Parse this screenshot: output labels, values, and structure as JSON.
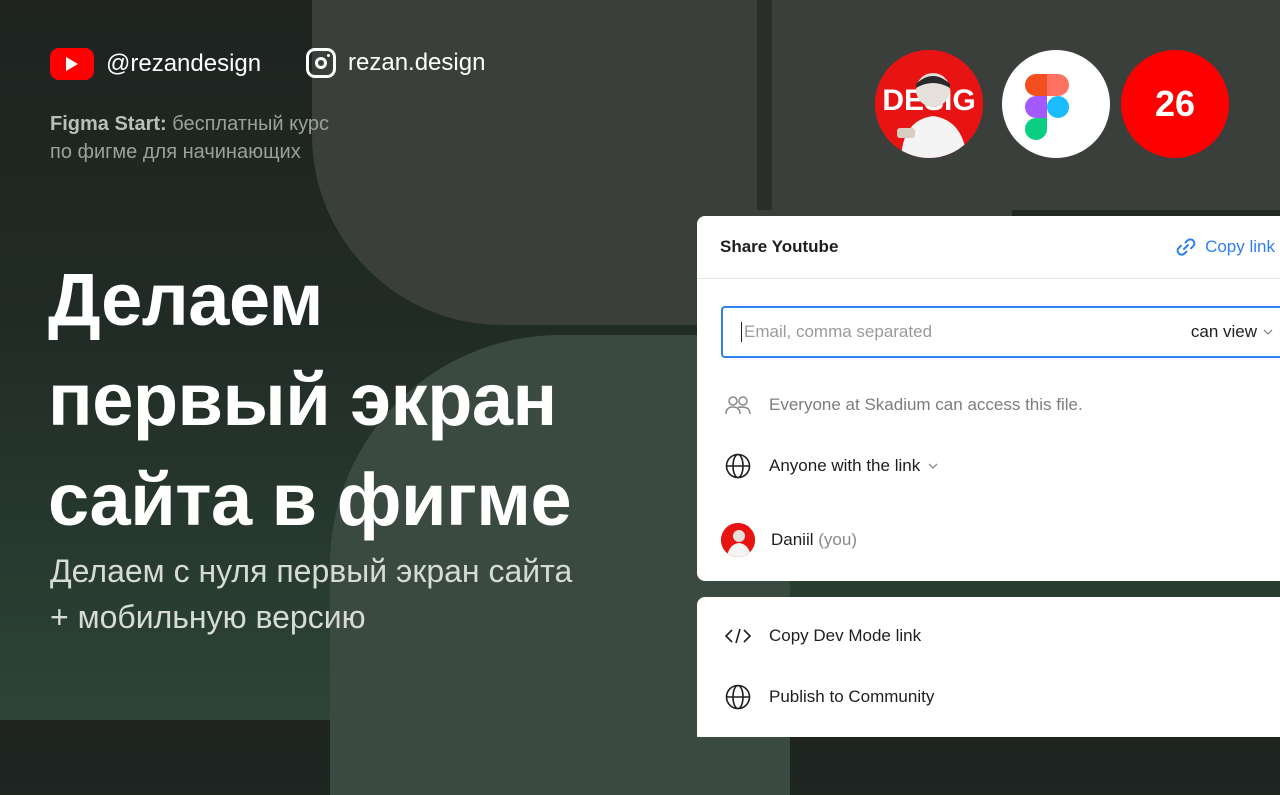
{
  "social": {
    "youtube_handle": "@rezandesign",
    "instagram_handle": "rezan.design"
  },
  "course": {
    "title": "Figma Start:",
    "description_line1": " бесплатный курс",
    "description_line2": "по фигме для начинающих"
  },
  "headline": {
    "line1": "Делаем",
    "line2": "первый экран",
    "line3": "сайта в фигме"
  },
  "subline": {
    "line1": "Делаем с нуля первый экран сайта",
    "line2": "+ мобильную версию"
  },
  "badges": {
    "avatar_text": "DESIG",
    "episode_number": "26"
  },
  "share_dialog": {
    "title": "Share Youtube",
    "copy_link_label": "Copy link",
    "email_placeholder": "Email, comma separated",
    "permission_value": "can view",
    "org_access_text": "Everyone at Skadium can access this file.",
    "link_access_value": "Anyone with the link",
    "user_name": "Daniil",
    "user_suffix": "(you)",
    "copy_dev_mode_label": "Copy Dev Mode link",
    "publish_label": "Publish to Community"
  },
  "colors": {
    "accent_blue": "#2f80ed",
    "youtube_red": "#ff0000",
    "background_dark": "#1e2320",
    "panel_white": "#ffffff"
  },
  "icons": [
    "youtube-icon",
    "instagram-icon",
    "figma-logo-icon",
    "link-icon",
    "chevron-down-icon",
    "people-icon",
    "globe-icon",
    "code-icon"
  ]
}
